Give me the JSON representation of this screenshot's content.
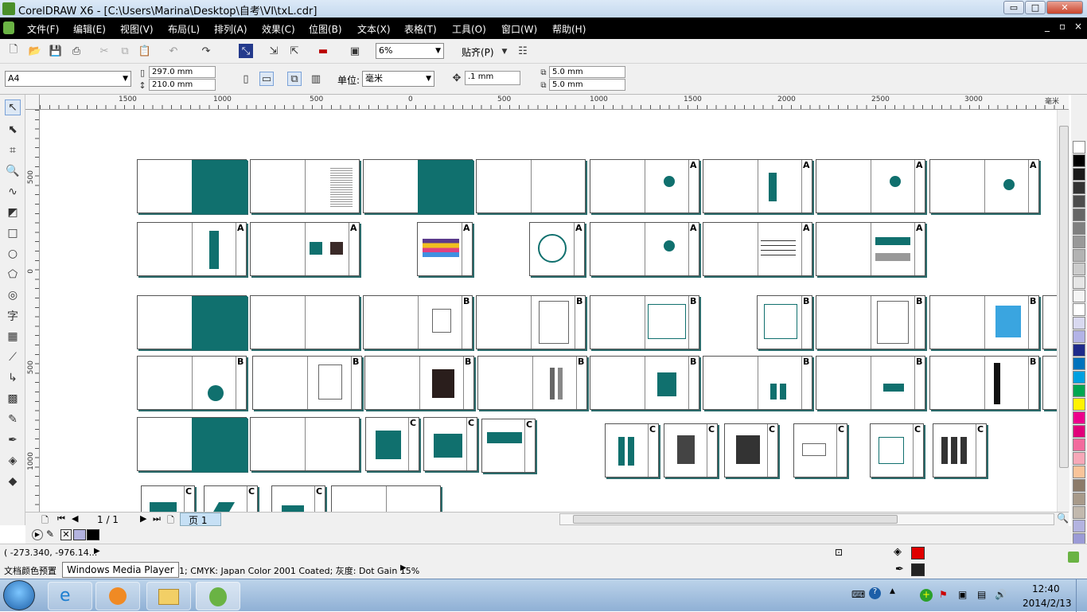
{
  "window": {
    "title": "CorelDRAW X6 - [C:\\Users\\Marina\\Desktop\\自考\\VI\\txL.cdr]",
    "btn_min": "▭",
    "btn_max": "□",
    "btn_close": "✕",
    "doc_min": "_",
    "doc_restore": "▫",
    "doc_close": "×"
  },
  "menu": [
    "文件(F)",
    "编辑(E)",
    "视图(V)",
    "布局(L)",
    "排列(A)",
    "效果(C)",
    "位图(B)",
    "文本(X)",
    "表格(T)",
    "工具(O)",
    "窗口(W)",
    "帮助(H)"
  ],
  "toolbar": {
    "zoom": "6%",
    "snap": "贴齐(P)"
  },
  "propbar": {
    "paper": "A4",
    "width": "297.0 mm",
    "height": "210.0 mm",
    "unit_label": "单位:",
    "unit": "毫米",
    "nudge": ".1 mm",
    "dup_x": "5.0 mm",
    "dup_y": "5.0 mm"
  },
  "ruler": {
    "h_labels": [
      "1500",
      "1000",
      "500",
      "0",
      "500",
      "1000",
      "1500",
      "2000",
      "2500",
      "3000"
    ],
    "h_unit": "毫米",
    "v_labels": [
      "500",
      "0",
      "500",
      "1000"
    ]
  },
  "pagebar": {
    "counter": "1 / 1",
    "page_tab": "页 1"
  },
  "status": {
    "coords": "( -273.340, -976.14... ",
    "profile": "文档颜色预置",
    "profile_rest": "1; CMYK: Japan Color 2001 Coated; 灰度: Dot Gain 15%",
    "tooltip": "Windows Media Player"
  },
  "colors": {
    "fill": "#e00000",
    "outline": "#222222",
    "teal": "#10706e"
  },
  "palette": [
    "#ffffff",
    "#000000",
    "#1a1a1a",
    "#333333",
    "#4d4d4d",
    "#666666",
    "#808080",
    "#999999",
    "#b3b3b3",
    "#cccccc",
    "#e6e6e6",
    "#f5f5f5",
    "#ffffff",
    "#d9d9f0",
    "#b3b3e6",
    "#1e2a8a",
    "#0072bc",
    "#00a0e0",
    "#00a651",
    "#fff200",
    "#ec008c",
    "#e0007a",
    "#f26b9d",
    "#f7a8b8",
    "#f9c49a",
    "#8c7b6a",
    "#a89a8a",
    "#c2b9ae",
    "#b3b3e0",
    "#9b9bd6",
    "#7f7fcc",
    "#6666bb"
  ],
  "taskbar": {
    "time": "12:40",
    "date": "2014/2/13"
  }
}
